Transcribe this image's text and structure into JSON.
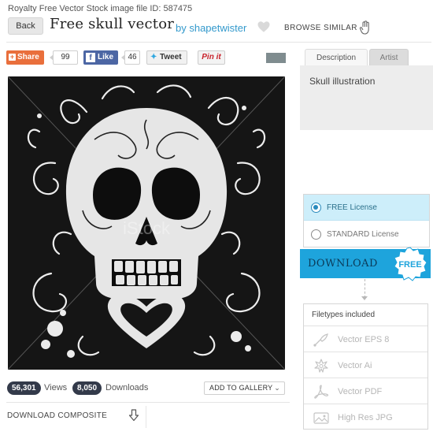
{
  "meta_line": "Royalty Free Vector Stock image file ID: 587475",
  "header": {
    "back_label": "Back",
    "title": "Free skull vector",
    "by_line": "by shapetwister",
    "browse_similar": "BROWSE SIMILAR"
  },
  "social": {
    "share_label": "Share",
    "share_count": "99",
    "like_label": "Like",
    "like_count": "46",
    "tweet_label": "Tweet",
    "pin_label": "Pin it"
  },
  "image": {
    "watermark": "iStock"
  },
  "stats": {
    "views_count": "56,301",
    "views_label": "Views",
    "downloads_count": "8,050",
    "downloads_label": "Downloads",
    "gallery_label": "ADD TO GALLERY"
  },
  "composite": {
    "label": "DOWNLOAD COMPOSITE"
  },
  "tabs": [
    {
      "label": "Description",
      "active": true
    },
    {
      "label": "Artist",
      "active": false
    }
  ],
  "description_text": "Skull illustration",
  "license": {
    "options": [
      {
        "label": "FREE License",
        "selected": true
      },
      {
        "label": "STANDARD License",
        "selected": false
      }
    ]
  },
  "download": {
    "label": "DOWNLOAD",
    "badge": "FREE"
  },
  "filetypes": {
    "title": "Filetypes included",
    "items": [
      {
        "label": "Vector EPS 8",
        "icon": "pen-nib-icon"
      },
      {
        "label": "Vector Ai",
        "icon": "illustrator-flower-icon"
      },
      {
        "label": "Vector PDF",
        "icon": "acrobat-pdf-icon"
      },
      {
        "label": "High Res JPG",
        "icon": "image-jpg-icon"
      }
    ]
  },
  "colors": {
    "link_blue": "#3399cc",
    "download_blue": "#1ea4dc",
    "free_license_bg": "#cdeefa",
    "share_orange": "#e96f3c",
    "facebook_blue": "#4c66a4",
    "pin_red": "#c8232c",
    "pill_dark": "#333a4a"
  }
}
